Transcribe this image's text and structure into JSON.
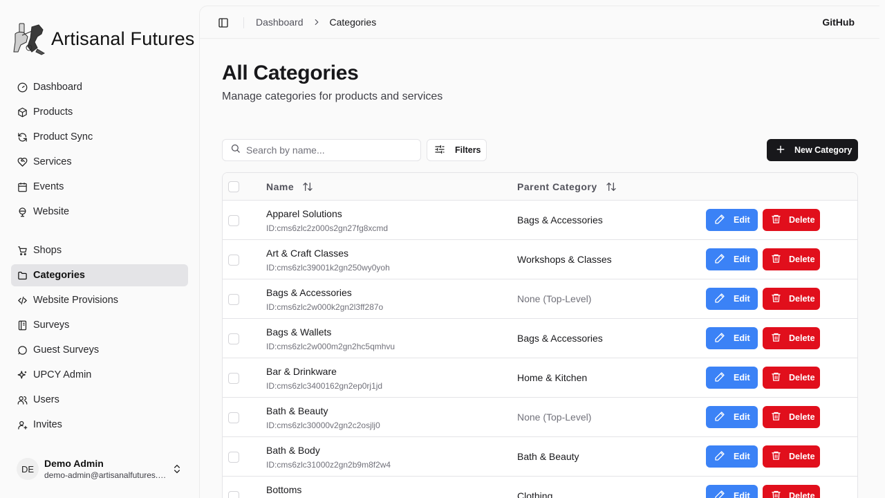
{
  "app": {
    "brand": "Artisanal Futures"
  },
  "sidebar": {
    "group1": [
      {
        "label": "Dashboard",
        "icon": "gauge-icon"
      },
      {
        "label": "Products",
        "icon": "package-icon"
      },
      {
        "label": "Product Sync",
        "icon": "refresh-icon"
      },
      {
        "label": "Services",
        "icon": "heart-handshake-icon"
      },
      {
        "label": "Events",
        "icon": "calendar-icon"
      },
      {
        "label": "Website",
        "icon": "globe-icon"
      }
    ],
    "group2": [
      {
        "label": "Shops",
        "icon": "cart-icon"
      },
      {
        "label": "Categories",
        "icon": "folder-icon",
        "active": true
      },
      {
        "label": "Website Provisions",
        "icon": "code-icon"
      },
      {
        "label": "Surveys",
        "icon": "notebook-icon"
      },
      {
        "label": "Guest Surveys",
        "icon": "message-circle-icon"
      },
      {
        "label": "UPCY Admin",
        "icon": "sparkles-icon"
      },
      {
        "label": "Users",
        "icon": "users-icon"
      },
      {
        "label": "Invites",
        "icon": "user-plus-icon"
      }
    ],
    "user": {
      "initials": "DE",
      "name": "Demo Admin",
      "email": "demo-admin@artisanalfutures.org"
    }
  },
  "header": {
    "breadcrumb": {
      "parent": "Dashboard",
      "current": "Categories"
    },
    "github": "GitHub"
  },
  "page": {
    "title": "All Categories",
    "subtitle": "Manage categories for products and services"
  },
  "toolbar": {
    "search_placeholder": "Search by name...",
    "filters_label": "Filters",
    "new_label": "New Category"
  },
  "table": {
    "columns": {
      "name": "Name",
      "parent": "Parent Category"
    },
    "edit_label": "Edit",
    "delete_label": "Delete",
    "rows": [
      {
        "name": "Apparel Solutions",
        "id": "ID:cms6zlc2z000s2gn27fg8xcmd",
        "parent": "Bags & Accessories",
        "top": false
      },
      {
        "name": "Art & Craft Classes",
        "id": "ID:cms6zlc39001k2gn250wy0yoh",
        "parent": "Workshops & Classes",
        "top": false
      },
      {
        "name": "Bags & Accessories",
        "id": "ID:cms6zlc2w000k2gn2l3ff287o",
        "parent": "None (Top-Level)",
        "top": true
      },
      {
        "name": "Bags & Wallets",
        "id": "ID:cms6zlc2w000m2gn2hc5qmhvu",
        "parent": "Bags & Accessories",
        "top": false
      },
      {
        "name": "Bar & Drinkware",
        "id": "ID:cms6zlc3400162gn2ep0rj1jd",
        "parent": "Home & Kitchen",
        "top": false
      },
      {
        "name": "Bath & Beauty",
        "id": "ID:cms6zlc30000v2gn2c2osjlj0",
        "parent": "None (Top-Level)",
        "top": true
      },
      {
        "name": "Bath & Body",
        "id": "ID:cms6zlc31000z2gn2b9m8f2w4",
        "parent": "Bath & Beauty",
        "top": false
      },
      {
        "name": "Bottoms",
        "id": "",
        "parent": "Clothing",
        "top": false
      }
    ]
  }
}
